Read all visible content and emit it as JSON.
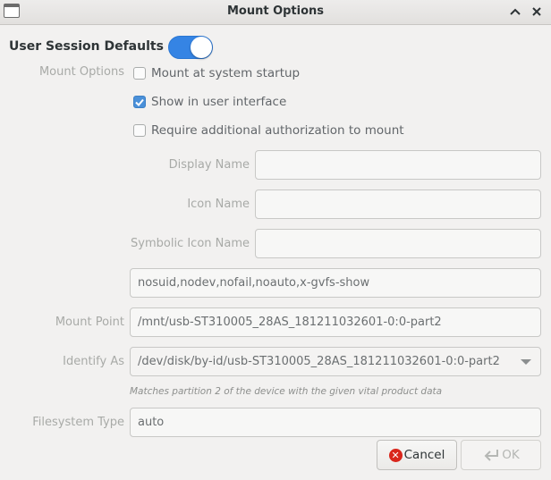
{
  "window": {
    "title": "Mount Options"
  },
  "header": {
    "session_defaults_label": "User Session Defaults",
    "session_defaults_enabled": true
  },
  "mount_options_label": "Mount Options",
  "checks": [
    {
      "label": "Mount at system startup",
      "checked": false
    },
    {
      "label": "Show in user interface",
      "checked": true
    },
    {
      "label": "Require additional authorization to mount",
      "checked": false
    }
  ],
  "fields": {
    "display_name": {
      "label": "Display Name",
      "value": ""
    },
    "icon_name": {
      "label": "Icon Name",
      "value": ""
    },
    "symbolic_icon_name": {
      "label": "Symbolic Icon Name",
      "value": ""
    },
    "options": {
      "value": "nosuid,nodev,nofail,noauto,x-gvfs-show"
    },
    "mount_point": {
      "label": "Mount Point",
      "value": "/mnt/usb-ST310005_28AS_181211032601-0:0-part2"
    },
    "identify_as": {
      "label": "Identify As",
      "value": "/dev/disk/by-id/usb-ST310005_28AS_181211032601-0:0-part2"
    },
    "identify_hint": "Matches partition 2 of the device with the given vital product data",
    "filesystem_type": {
      "label": "Filesystem Type",
      "value": "auto"
    }
  },
  "buttons": {
    "cancel": "Cancel",
    "ok": "OK"
  },
  "colors": {
    "accent": "#3584e4",
    "cancel_icon": "#d9261c"
  }
}
